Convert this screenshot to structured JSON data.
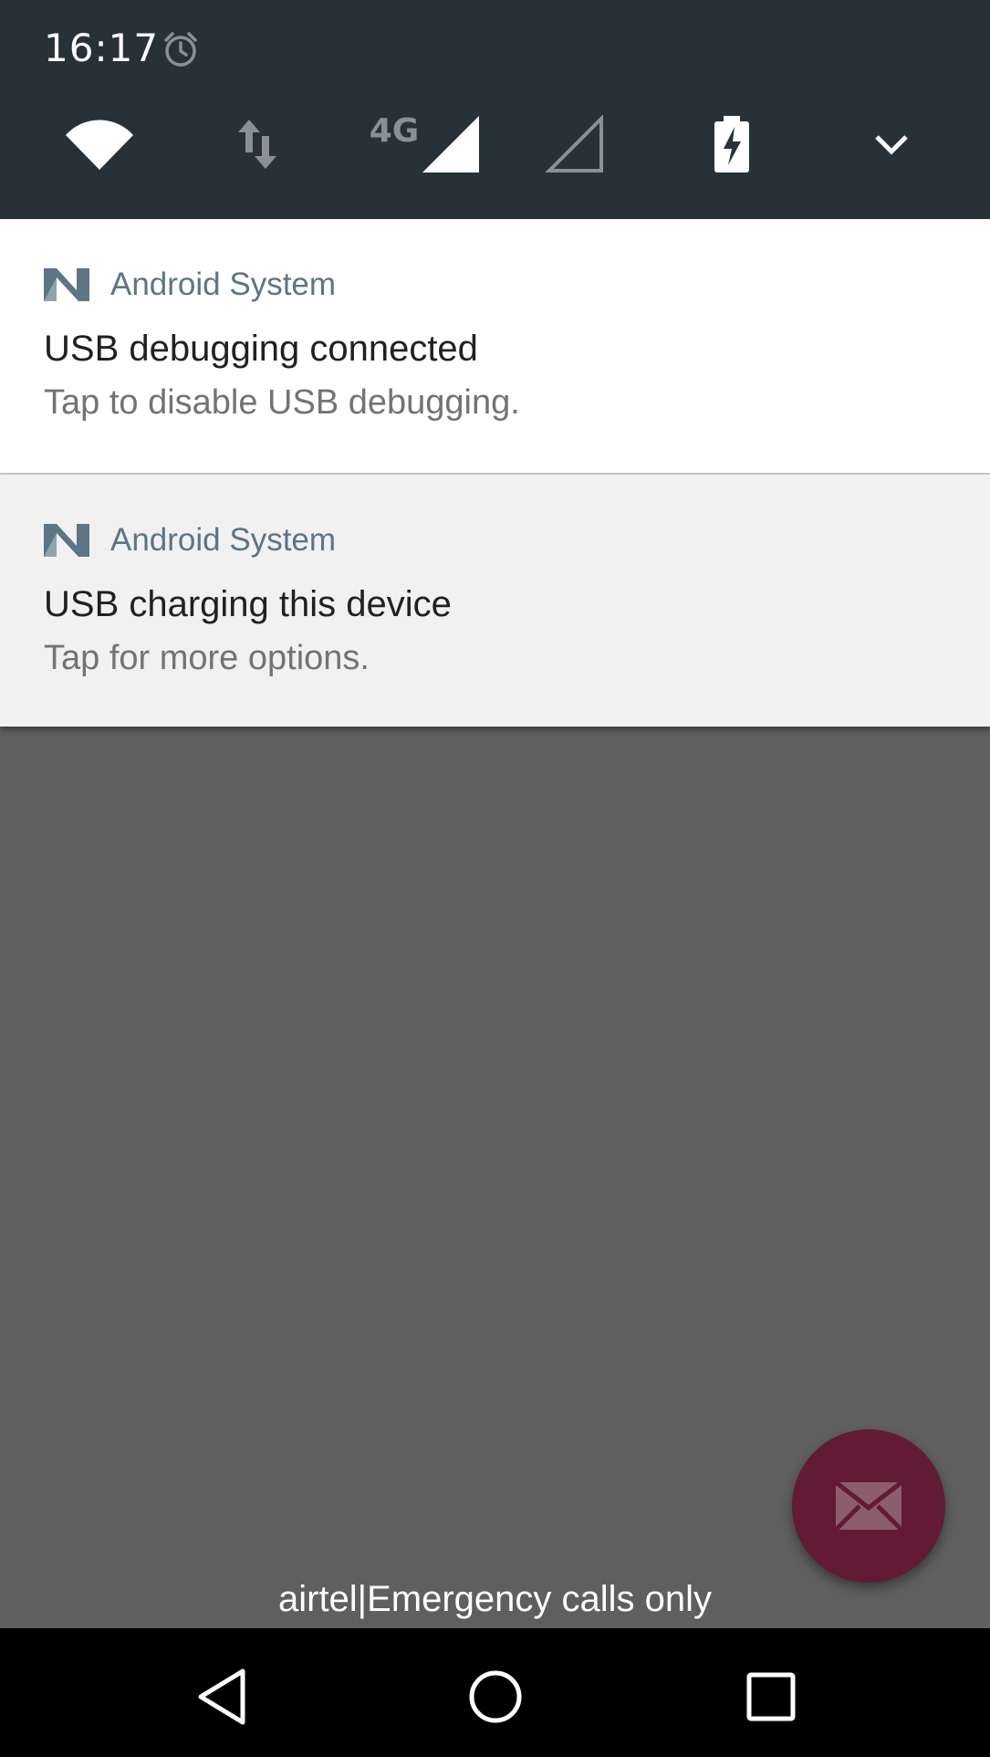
{
  "status_bar": {
    "time": "16:17",
    "icons": [
      "alarm-icon"
    ]
  },
  "quick_settings": {
    "items": [
      "wifi-icon",
      "data-transfer-icon",
      "cell-signal-icon",
      "cell-signal-empty-icon",
      "battery-charging-icon",
      "expand-chevron-icon"
    ],
    "network_type": "4G"
  },
  "notifications": [
    {
      "app": "Android System",
      "title": "USB debugging connected",
      "text": "Tap to disable USB debugging."
    },
    {
      "app": "Android System",
      "title": "USB charging this device",
      "text": "Tap for more options."
    }
  ],
  "lockscreen": {
    "carrier_text": "airtel|Emergency calls only"
  },
  "colors": {
    "header_bg": "#263238",
    "scrim_bg": "#5f5f5f",
    "fab_bg": "#621a35",
    "app_name": "#5d7585"
  }
}
